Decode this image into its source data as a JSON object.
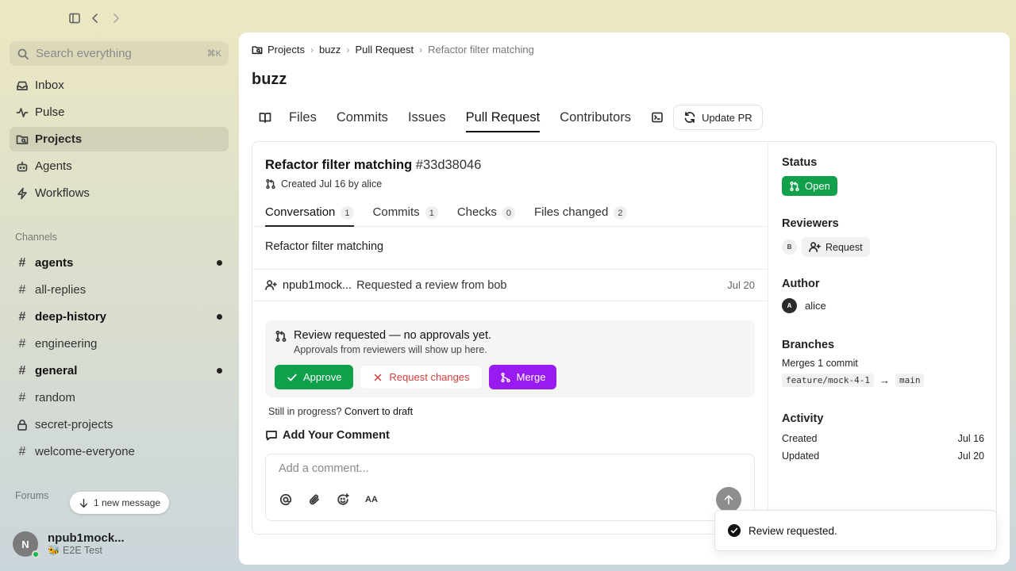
{
  "sidebar": {
    "search": {
      "placeholder": "Search everything",
      "shortcut": "⌘K"
    },
    "nav": [
      {
        "label": "Inbox",
        "icon": "inbox-icon"
      },
      {
        "label": "Pulse",
        "icon": "pulse-icon"
      },
      {
        "label": "Projects",
        "icon": "projects-icon",
        "active": true
      },
      {
        "label": "Agents",
        "icon": "bot-icon"
      },
      {
        "label": "Workflows",
        "icon": "lightning-icon"
      }
    ],
    "channels_label": "Channels",
    "channels": [
      {
        "name": "agents",
        "unread": true
      },
      {
        "name": "all-replies",
        "unread": false
      },
      {
        "name": "deep-history",
        "unread": true
      },
      {
        "name": "engineering",
        "unread": false
      },
      {
        "name": "general",
        "unread": true
      },
      {
        "name": "random",
        "unread": false
      },
      {
        "name": "secret-projects",
        "unread": false,
        "private": true
      },
      {
        "name": "welcome-everyone",
        "unread": false
      }
    ],
    "forums_label": "Forums",
    "new_message": "1 new message",
    "user": {
      "initial": "N",
      "name": "npub1mock...",
      "status": "🐝 E2E Test"
    }
  },
  "main": {
    "breadcrumb": [
      "Projects",
      "buzz",
      "Pull Request",
      "Refactor filter matching"
    ],
    "repo_title": "buzz",
    "tabs": [
      "Files",
      "Commits",
      "Issues",
      "Pull Request",
      "Contributors"
    ],
    "active_tab": "Pull Request",
    "update_pr": "Update PR",
    "pr": {
      "title": "Refactor filter matching",
      "hash": "#33d38046",
      "meta": "Created Jul 16 by alice",
      "subtabs": [
        {
          "label": "Conversation",
          "count": "1"
        },
        {
          "label": "Commits",
          "count": "1"
        },
        {
          "label": "Checks",
          "count": "0"
        },
        {
          "label": "Files changed",
          "count": "2"
        }
      ],
      "description": "Refactor filter matching",
      "event": {
        "who": "npub1mock...",
        "what": "Requested a review from bob",
        "when": "Jul 20"
      },
      "review": {
        "title": "Review requested — no approvals yet.",
        "subtitle": "Approvals from reviewers will show up here.",
        "approve": "Approve",
        "request_changes": "Request changes",
        "merge": "Merge"
      },
      "draft_prefix": "Still in progress?",
      "draft_link": "Convert to draft",
      "comment_heading": "Add Your Comment",
      "comment_placeholder": "Add a comment...",
      "format_label": "AA"
    },
    "side": {
      "status_label": "Status",
      "status": "Open",
      "reviewers_label": "Reviewers",
      "reviewer_initial": "B",
      "request": "Request",
      "author_label": "Author",
      "author_initial": "A",
      "author": "alice",
      "branches_label": "Branches",
      "merges": "Merges 1 commit",
      "from_branch": "feature/mock-4-1",
      "arrow": "→",
      "to_branch": "main",
      "activity_label": "Activity",
      "created_label": "Created",
      "created": "Jul 16",
      "updated_label": "Updated",
      "updated": "Jul 20"
    }
  },
  "toast": "Review requested.",
  "colors": {
    "approve": "#0fa04a",
    "merge": "#9a1bf0",
    "open": "#12a14b",
    "danger": "#d43d3d"
  }
}
